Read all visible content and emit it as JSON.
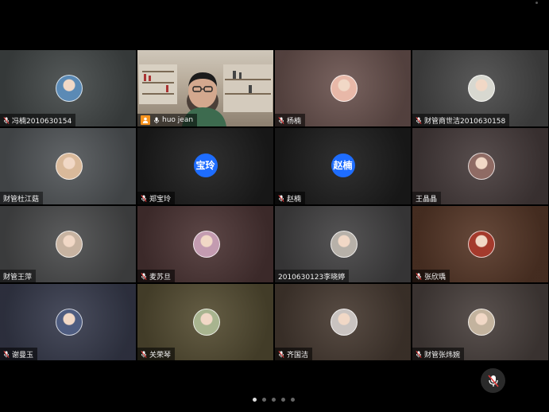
{
  "participants": [
    {
      "name": "冯楠2010630154",
      "mic": "muted",
      "avatar": "photo",
      "bg": "#474c4c",
      "av": "#5b8ab5"
    },
    {
      "name": "huo jean",
      "mic": "on",
      "avatar": "video",
      "featured": true,
      "host": true,
      "bg": "#8a7f72",
      "av": "#444"
    },
    {
      "name": "杨楠",
      "mic": "muted",
      "avatar": "photo",
      "bg": "#6e5652",
      "av": "#e8b8a8"
    },
    {
      "name": "财管商世洁2010630158",
      "mic": "muted",
      "avatar": "photo",
      "bg": "#4c4c4c",
      "av": "#d8d8d0"
    },
    {
      "name": "财管杜江菇",
      "mic": "none",
      "avatar": "photo",
      "bg": "#55595c",
      "av": "#d9b99a"
    },
    {
      "name": "郑宝玲",
      "mic": "muted",
      "avatar": "text",
      "initials": "宝玲",
      "bg": "#1f1f1f"
    },
    {
      "name": "赵楠",
      "mic": "muted",
      "avatar": "text",
      "initials": "赵楠",
      "bg": "#1f1f1f"
    },
    {
      "name": "王晶晶",
      "mic": "none",
      "avatar": "photo",
      "bg": "#4a3f3f",
      "av": "#8f6b64"
    },
    {
      "name": "财管王萍",
      "mic": "none",
      "avatar": "photo",
      "bg": "#4e4f50",
      "av": "#c7b3a1"
    },
    {
      "name": "麦苏旦",
      "mic": "muted",
      "avatar": "photo",
      "bg": "#4f3737",
      "av": "#c39bb0"
    },
    {
      "name": "2010630123李晓婷",
      "mic": "none",
      "avatar": "photo",
      "bg": "#474647",
      "av": "#b7b1a9"
    },
    {
      "name": "张欣瑀",
      "mic": "muted",
      "avatar": "photo",
      "bg": "#5a3a2a",
      "av": "#a43a2c"
    },
    {
      "name": "谢曼玉",
      "mic": "muted",
      "avatar": "photo",
      "bg": "#3a3e50",
      "av": "#4e5c80"
    },
    {
      "name": "关荣琴",
      "mic": "muted",
      "avatar": "photo",
      "bg": "#585035",
      "av": "#a8b48f"
    },
    {
      "name": "齐国洁",
      "mic": "muted",
      "avatar": "photo",
      "bg": "#4a3d34",
      "av": "#c9c3c0"
    },
    {
      "name": "财管张炜婉",
      "mic": "muted",
      "avatar": "photo",
      "bg": "#4c4340",
      "av": "#c3b39e"
    }
  ],
  "controls": {
    "bottom_mic": "mic-muted-icon"
  },
  "pager": {
    "count": 5,
    "active": 0
  },
  "colors": {
    "accent": "#1e6dff",
    "active_speaker": "#4cd263",
    "host_badge": "#f7931e"
  }
}
